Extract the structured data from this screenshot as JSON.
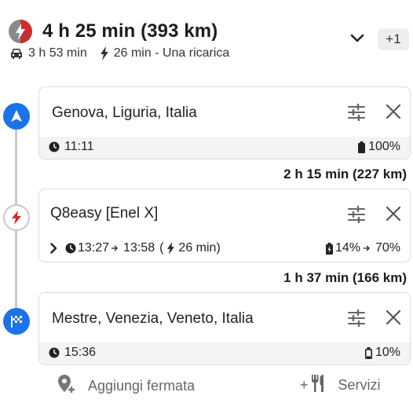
{
  "header": {
    "title": "4 h 25 min (393 km)",
    "drive_time": "3 h 53 min",
    "charge_info": "26 min - Una ricarica",
    "extra_count": "+1"
  },
  "stops": [
    {
      "place": "Genova, Liguria, Italia",
      "time": "11:11",
      "battery": "100%",
      "marker": "navigation-arrow-icon"
    },
    {
      "place": "Q8easy [Enel X]",
      "arrive": "13:27",
      "depart": "13:58",
      "charge_duration": "26 min",
      "battery_from": "14%",
      "battery_to": "70%",
      "marker": "charging-station-icon"
    },
    {
      "place": "Mestre, Venezia, Veneto, Italia",
      "time": "15:36",
      "battery": "10%",
      "marker": "finish-flag-icon"
    }
  ],
  "segments": [
    "2 h 15 min (227 km)",
    "1 h 37 min (166 km)"
  ],
  "actions": {
    "add_stop": "Aggiungi fermata",
    "services_prefix": "+",
    "services": "Servizi"
  },
  "colors": {
    "accent": "#1a73e8",
    "charge_red": "#d22b2b",
    "rail": "#c8c8c8"
  }
}
